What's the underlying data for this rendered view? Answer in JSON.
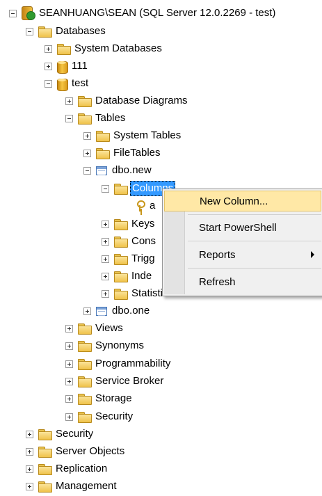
{
  "tree": {
    "server": "SEANHUANG\\SEAN (SQL Server 12.0.2269 - test)",
    "databases": "Databases",
    "system_databases": "System Databases",
    "db_111": "111",
    "db_test": "test",
    "database_diagrams": "Database Diagrams",
    "tables": "Tables",
    "system_tables": "System Tables",
    "filetables": "FileTables",
    "dbo_new": "dbo.new",
    "columns": "Columns",
    "column_a": "a",
    "keys": "Keys",
    "constraints": "Cons",
    "triggers": "Trigg",
    "indexes": "Inde",
    "statistics": "Statistics",
    "dbo_one": "dbo.one",
    "views": "Views",
    "synonyms": "Synonyms",
    "programmability": "Programmability",
    "service_broker": "Service Broker",
    "storage": "Storage",
    "db_security": "Security",
    "security": "Security",
    "server_objects": "Server Objects",
    "replication": "Replication",
    "management": "Management"
  },
  "context_menu": {
    "new_column": "New Column...",
    "start_powershell": "Start PowerShell",
    "reports": "Reports",
    "refresh": "Refresh"
  },
  "colors": {
    "selection": "#3399ff",
    "menu_hover": "#ffe8a6"
  }
}
